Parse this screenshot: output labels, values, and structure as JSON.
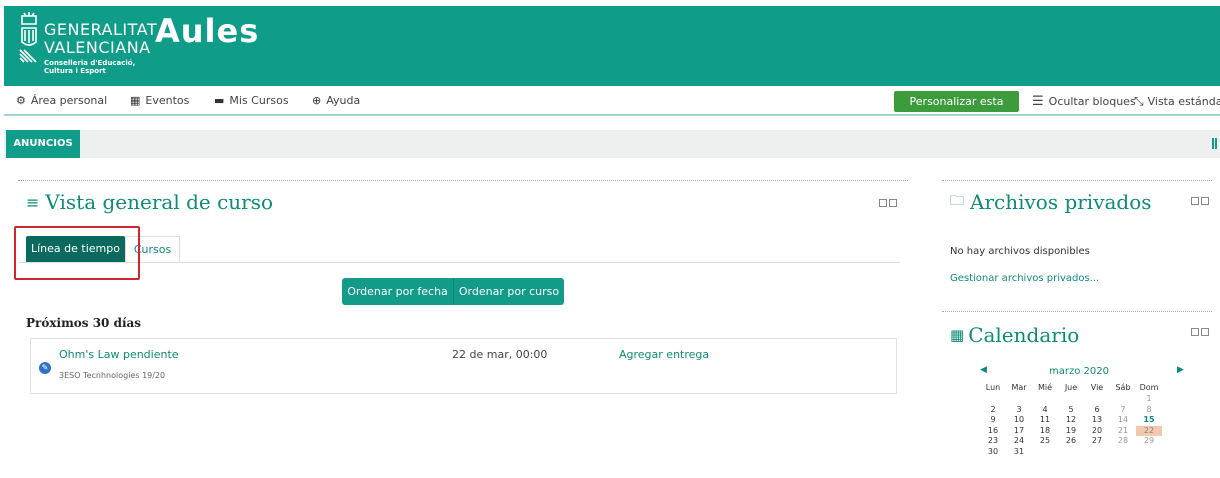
{
  "header": {
    "brand_line1": "GENERALITAT",
    "brand_line2": "VALENCIANA",
    "brand_sub1": "Conselleria d'Educació,",
    "brand_sub2": "Cultura i Esport",
    "app_name": "Aules",
    "color": "#0f9d89"
  },
  "nav": {
    "items": [
      {
        "label": "Área personal",
        "icon": "dashboard-icon"
      },
      {
        "label": "Eventos",
        "icon": "calendar-icon"
      },
      {
        "label": "Mis Cursos",
        "icon": "briefcase-icon"
      },
      {
        "label": "Ayuda",
        "icon": "lifebuoy-icon"
      }
    ],
    "customize_label": "Personalizar esta página",
    "hide_blocks_label": "Ocultar bloques",
    "standard_view_label": "Vista estándar"
  },
  "announcements": {
    "tab_label": "ANUNCIOS"
  },
  "overview": {
    "title": "Vista general de curso",
    "tabs": [
      {
        "label": "Línea de tiempo",
        "active": true
      },
      {
        "label": "Cursos",
        "active": false
      }
    ],
    "sort_by_date": "Ordenar por fecha",
    "sort_by_course": "Ordenar por curso",
    "section_heading": "Próximos 30 días",
    "events": [
      {
        "name": "Ohm's Law pendiente",
        "course": "3ESO Tecnhnologies 19/20",
        "date": "22 de mar, 00:00",
        "action": "Agregar entrega"
      }
    ]
  },
  "private_files": {
    "title": "Archivos privados",
    "empty_text": "No hay archivos disponibles",
    "manage_link": "Gestionar archivos privados..."
  },
  "calendar": {
    "title": "Calendario",
    "month": "marzo 2020",
    "weekdays": [
      "Lun",
      "Mar",
      "Mié",
      "Jue",
      "Vie",
      "Sáb",
      "Dom"
    ],
    "weeks": [
      [
        "",
        "",
        "",
        "",
        "",
        "",
        "1"
      ],
      [
        "2",
        "3",
        "4",
        "5",
        "6",
        "7",
        "8"
      ],
      [
        "9",
        "10",
        "11",
        "12",
        "13",
        "14",
        "15"
      ],
      [
        "16",
        "17",
        "18",
        "19",
        "20",
        "21",
        "22"
      ],
      [
        "23",
        "24",
        "25",
        "26",
        "27",
        "28",
        "29"
      ],
      [
        "30",
        "31",
        "",
        "",
        "",
        "",
        ""
      ]
    ],
    "today": "22",
    "event_day": "15"
  }
}
